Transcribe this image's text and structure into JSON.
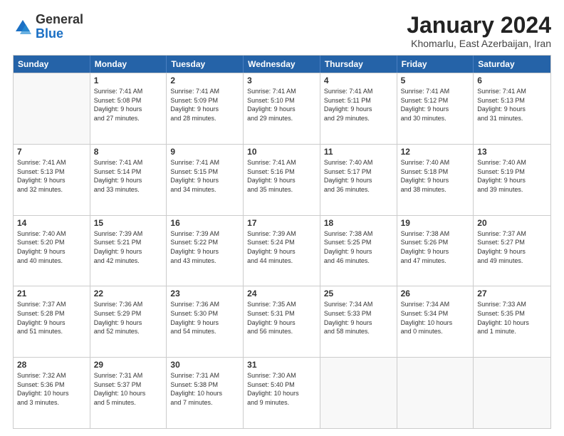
{
  "logo": {
    "general": "General",
    "blue": "Blue"
  },
  "title": {
    "month": "January 2024",
    "location": "Khomarlu, East Azerbaijan, Iran"
  },
  "header_days": [
    "Sunday",
    "Monday",
    "Tuesday",
    "Wednesday",
    "Thursday",
    "Friday",
    "Saturday"
  ],
  "rows": [
    [
      {
        "day": "",
        "lines": []
      },
      {
        "day": "1",
        "lines": [
          "Sunrise: 7:41 AM",
          "Sunset: 5:08 PM",
          "Daylight: 9 hours",
          "and 27 minutes."
        ]
      },
      {
        "day": "2",
        "lines": [
          "Sunrise: 7:41 AM",
          "Sunset: 5:09 PM",
          "Daylight: 9 hours",
          "and 28 minutes."
        ]
      },
      {
        "day": "3",
        "lines": [
          "Sunrise: 7:41 AM",
          "Sunset: 5:10 PM",
          "Daylight: 9 hours",
          "and 29 minutes."
        ]
      },
      {
        "day": "4",
        "lines": [
          "Sunrise: 7:41 AM",
          "Sunset: 5:11 PM",
          "Daylight: 9 hours",
          "and 29 minutes."
        ]
      },
      {
        "day": "5",
        "lines": [
          "Sunrise: 7:41 AM",
          "Sunset: 5:12 PM",
          "Daylight: 9 hours",
          "and 30 minutes."
        ]
      },
      {
        "day": "6",
        "lines": [
          "Sunrise: 7:41 AM",
          "Sunset: 5:13 PM",
          "Daylight: 9 hours",
          "and 31 minutes."
        ]
      }
    ],
    [
      {
        "day": "7",
        "lines": [
          "Sunrise: 7:41 AM",
          "Sunset: 5:13 PM",
          "Daylight: 9 hours",
          "and 32 minutes."
        ]
      },
      {
        "day": "8",
        "lines": [
          "Sunrise: 7:41 AM",
          "Sunset: 5:14 PM",
          "Daylight: 9 hours",
          "and 33 minutes."
        ]
      },
      {
        "day": "9",
        "lines": [
          "Sunrise: 7:41 AM",
          "Sunset: 5:15 PM",
          "Daylight: 9 hours",
          "and 34 minutes."
        ]
      },
      {
        "day": "10",
        "lines": [
          "Sunrise: 7:41 AM",
          "Sunset: 5:16 PM",
          "Daylight: 9 hours",
          "and 35 minutes."
        ]
      },
      {
        "day": "11",
        "lines": [
          "Sunrise: 7:40 AM",
          "Sunset: 5:17 PM",
          "Daylight: 9 hours",
          "and 36 minutes."
        ]
      },
      {
        "day": "12",
        "lines": [
          "Sunrise: 7:40 AM",
          "Sunset: 5:18 PM",
          "Daylight: 9 hours",
          "and 38 minutes."
        ]
      },
      {
        "day": "13",
        "lines": [
          "Sunrise: 7:40 AM",
          "Sunset: 5:19 PM",
          "Daylight: 9 hours",
          "and 39 minutes."
        ]
      }
    ],
    [
      {
        "day": "14",
        "lines": [
          "Sunrise: 7:40 AM",
          "Sunset: 5:20 PM",
          "Daylight: 9 hours",
          "and 40 minutes."
        ]
      },
      {
        "day": "15",
        "lines": [
          "Sunrise: 7:39 AM",
          "Sunset: 5:21 PM",
          "Daylight: 9 hours",
          "and 42 minutes."
        ]
      },
      {
        "day": "16",
        "lines": [
          "Sunrise: 7:39 AM",
          "Sunset: 5:22 PM",
          "Daylight: 9 hours",
          "and 43 minutes."
        ]
      },
      {
        "day": "17",
        "lines": [
          "Sunrise: 7:39 AM",
          "Sunset: 5:24 PM",
          "Daylight: 9 hours",
          "and 44 minutes."
        ]
      },
      {
        "day": "18",
        "lines": [
          "Sunrise: 7:38 AM",
          "Sunset: 5:25 PM",
          "Daylight: 9 hours",
          "and 46 minutes."
        ]
      },
      {
        "day": "19",
        "lines": [
          "Sunrise: 7:38 AM",
          "Sunset: 5:26 PM",
          "Daylight: 9 hours",
          "and 47 minutes."
        ]
      },
      {
        "day": "20",
        "lines": [
          "Sunrise: 7:37 AM",
          "Sunset: 5:27 PM",
          "Daylight: 9 hours",
          "and 49 minutes."
        ]
      }
    ],
    [
      {
        "day": "21",
        "lines": [
          "Sunrise: 7:37 AM",
          "Sunset: 5:28 PM",
          "Daylight: 9 hours",
          "and 51 minutes."
        ]
      },
      {
        "day": "22",
        "lines": [
          "Sunrise: 7:36 AM",
          "Sunset: 5:29 PM",
          "Daylight: 9 hours",
          "and 52 minutes."
        ]
      },
      {
        "day": "23",
        "lines": [
          "Sunrise: 7:36 AM",
          "Sunset: 5:30 PM",
          "Daylight: 9 hours",
          "and 54 minutes."
        ]
      },
      {
        "day": "24",
        "lines": [
          "Sunrise: 7:35 AM",
          "Sunset: 5:31 PM",
          "Daylight: 9 hours",
          "and 56 minutes."
        ]
      },
      {
        "day": "25",
        "lines": [
          "Sunrise: 7:34 AM",
          "Sunset: 5:33 PM",
          "Daylight: 9 hours",
          "and 58 minutes."
        ]
      },
      {
        "day": "26",
        "lines": [
          "Sunrise: 7:34 AM",
          "Sunset: 5:34 PM",
          "Daylight: 10 hours",
          "and 0 minutes."
        ]
      },
      {
        "day": "27",
        "lines": [
          "Sunrise: 7:33 AM",
          "Sunset: 5:35 PM",
          "Daylight: 10 hours",
          "and 1 minute."
        ]
      }
    ],
    [
      {
        "day": "28",
        "lines": [
          "Sunrise: 7:32 AM",
          "Sunset: 5:36 PM",
          "Daylight: 10 hours",
          "and 3 minutes."
        ]
      },
      {
        "day": "29",
        "lines": [
          "Sunrise: 7:31 AM",
          "Sunset: 5:37 PM",
          "Daylight: 10 hours",
          "and 5 minutes."
        ]
      },
      {
        "day": "30",
        "lines": [
          "Sunrise: 7:31 AM",
          "Sunset: 5:38 PM",
          "Daylight: 10 hours",
          "and 7 minutes."
        ]
      },
      {
        "day": "31",
        "lines": [
          "Sunrise: 7:30 AM",
          "Sunset: 5:40 PM",
          "Daylight: 10 hours",
          "and 9 minutes."
        ]
      },
      {
        "day": "",
        "lines": []
      },
      {
        "day": "",
        "lines": []
      },
      {
        "day": "",
        "lines": []
      }
    ]
  ]
}
